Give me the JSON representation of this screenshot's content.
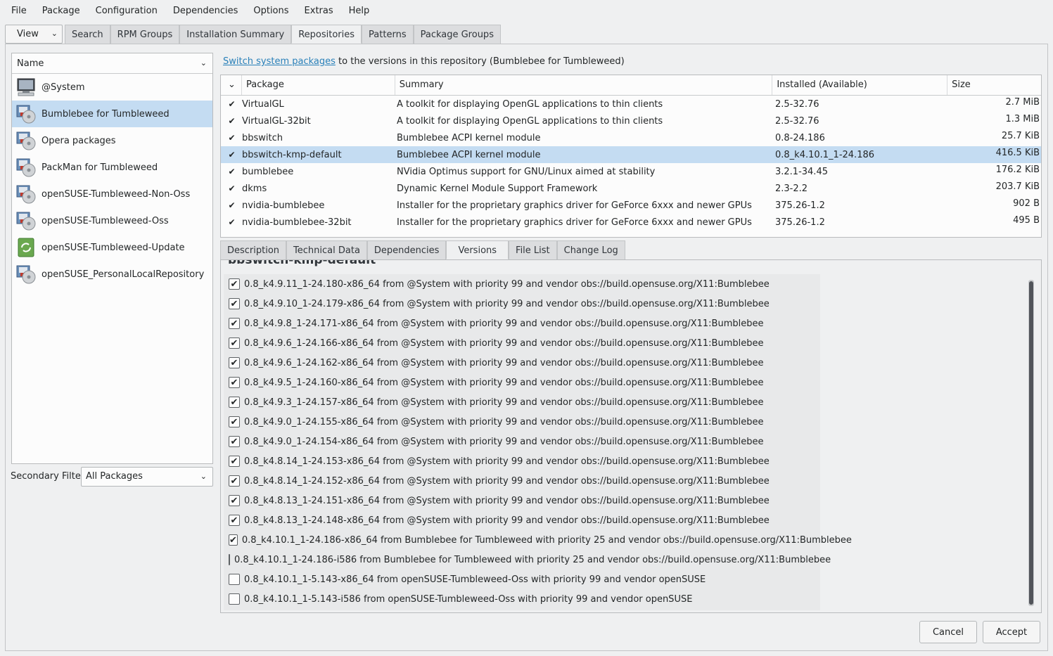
{
  "menubar": [
    "File",
    "Package",
    "Configuration",
    "Dependencies",
    "Options",
    "Extras",
    "Help"
  ],
  "view_button": "View",
  "top_tabs": [
    "Search",
    "RPM Groups",
    "Installation Summary",
    "Repositories",
    "Patterns",
    "Package Groups"
  ],
  "active_top_tab": "Repositories",
  "repo_list": {
    "header": "Name",
    "items": [
      {
        "name": "@System",
        "icon": "computer-icon"
      },
      {
        "name": "Bumblebee for Tumbleweed",
        "icon": "repository-disk-icon",
        "selected": true
      },
      {
        "name": "Opera packages",
        "icon": "repository-disk-icon"
      },
      {
        "name": "PackMan for Tumbleweed",
        "icon": "repository-disk-icon"
      },
      {
        "name": "openSUSE-Tumbleweed-Non-Oss",
        "icon": "repository-disk-icon"
      },
      {
        "name": "openSUSE-Tumbleweed-Oss",
        "icon": "repository-disk-icon"
      },
      {
        "name": "openSUSE-Tumbleweed-Update",
        "icon": "update-icon"
      },
      {
        "name": "openSUSE_PersonalLocalRepository",
        "icon": "repository-disk-icon"
      }
    ]
  },
  "secondary_filter": {
    "label": "Secondary Filter",
    "value": "All Packages"
  },
  "switch_line": {
    "link": "Switch system packages",
    "rest": " to the versions in this repository (Bumblebee for Tumbleweed)"
  },
  "packages": {
    "columns": [
      "Package",
      "Summary",
      "Installed (Available)",
      "Size"
    ],
    "rows": [
      {
        "name": "VirtualGL",
        "summary": "A toolkit for displaying OpenGL applications to thin clients",
        "version": "2.5-32.76",
        "size": "2.7 MiB"
      },
      {
        "name": "VirtualGL-32bit",
        "summary": "A toolkit for displaying OpenGL applications to thin clients",
        "version": "2.5-32.76",
        "size": "1.3 MiB"
      },
      {
        "name": "bbswitch",
        "summary": "Bumblebee ACPI kernel module",
        "version": "0.8-24.186",
        "size": "25.7 KiB"
      },
      {
        "name": "bbswitch-kmp-default",
        "summary": "Bumblebee ACPI kernel module",
        "version": "0.8_k4.10.1_1-24.186",
        "size": "416.5 KiB",
        "selected": true
      },
      {
        "name": "bumblebee",
        "summary": "NVidia Optimus support for GNU/Linux aimed at stability",
        "version": "3.2.1-34.45",
        "size": "176.2 KiB"
      },
      {
        "name": "dkms",
        "summary": "Dynamic Kernel Module Support Framework",
        "version": "2.3-2.2",
        "size": "203.7 KiB"
      },
      {
        "name": "nvidia-bumblebee",
        "summary": "Installer for the proprietary graphics driver for GeForce 6xxx and newer GPUs",
        "version": "375.26-1.2",
        "size": "902 B"
      },
      {
        "name": "nvidia-bumblebee-32bit",
        "summary": "Installer for the proprietary graphics driver for GeForce 6xxx and newer GPUs",
        "version": "375.26-1.2",
        "size": "495 B"
      }
    ]
  },
  "detail_tabs": [
    "Description",
    "Technical Data",
    "Dependencies",
    "Versions",
    "File List",
    "Change Log"
  ],
  "active_detail_tab": "Versions",
  "versions": {
    "title": "bbswitch-kmp-default",
    "items": [
      {
        "text": "0.8_k4.9.11_1-24.180-x86_64 from @System with priority 99 and vendor obs://build.opensuse.org/X11:Bumblebee",
        "checked": true
      },
      {
        "text": "0.8_k4.9.10_1-24.179-x86_64 from @System with priority 99 and vendor obs://build.opensuse.org/X11:Bumblebee",
        "checked": true
      },
      {
        "text": "0.8_k4.9.8_1-24.171-x86_64 from @System with priority 99 and vendor obs://build.opensuse.org/X11:Bumblebee",
        "checked": true
      },
      {
        "text": "0.8_k4.9.6_1-24.166-x86_64 from @System with priority 99 and vendor obs://build.opensuse.org/X11:Bumblebee",
        "checked": true
      },
      {
        "text": "0.8_k4.9.6_1-24.162-x86_64 from @System with priority 99 and vendor obs://build.opensuse.org/X11:Bumblebee",
        "checked": true
      },
      {
        "text": "0.8_k4.9.5_1-24.160-x86_64 from @System with priority 99 and vendor obs://build.opensuse.org/X11:Bumblebee",
        "checked": true
      },
      {
        "text": "0.8_k4.9.3_1-24.157-x86_64 from @System with priority 99 and vendor obs://build.opensuse.org/X11:Bumblebee",
        "checked": true
      },
      {
        "text": "0.8_k4.9.0_1-24.155-x86_64 from @System with priority 99 and vendor obs://build.opensuse.org/X11:Bumblebee",
        "checked": true
      },
      {
        "text": "0.8_k4.9.0_1-24.154-x86_64 from @System with priority 99 and vendor obs://build.opensuse.org/X11:Bumblebee",
        "checked": true
      },
      {
        "text": "0.8_k4.8.14_1-24.153-x86_64 from @System with priority 99 and vendor obs://build.opensuse.org/X11:Bumblebee",
        "checked": true
      },
      {
        "text": "0.8_k4.8.14_1-24.152-x86_64 from @System with priority 99 and vendor obs://build.opensuse.org/X11:Bumblebee",
        "checked": true
      },
      {
        "text": "0.8_k4.8.13_1-24.151-x86_64 from @System with priority 99 and vendor obs://build.opensuse.org/X11:Bumblebee",
        "checked": true
      },
      {
        "text": "0.8_k4.8.13_1-24.148-x86_64 from @System with priority 99 and vendor obs://build.opensuse.org/X11:Bumblebee",
        "checked": true
      },
      {
        "text": "0.8_k4.10.1_1-24.186-x86_64 from Bumblebee for Tumbleweed with priority 25 and vendor obs://build.opensuse.org/X11:Bumblebee",
        "checked": true
      },
      {
        "text": "0.8_k4.10.1_1-24.186-i586 from Bumblebee for Tumbleweed with priority 25 and vendor obs://build.opensuse.org/X11:Bumblebee",
        "checked": false
      },
      {
        "text": "0.8_k4.10.1_1-5.143-x86_64 from openSUSE-Tumbleweed-Oss with priority 99 and vendor openSUSE",
        "checked": false
      },
      {
        "text": "0.8_k4.10.1_1-5.143-i586 from openSUSE-Tumbleweed-Oss with priority 99 and vendor openSUSE",
        "checked": false
      }
    ]
  },
  "buttons": {
    "cancel": "Cancel",
    "accept": "Accept"
  },
  "colors": {
    "selection": "#c4dcf2",
    "link": "#2980b9",
    "window": "#eff0f1"
  }
}
